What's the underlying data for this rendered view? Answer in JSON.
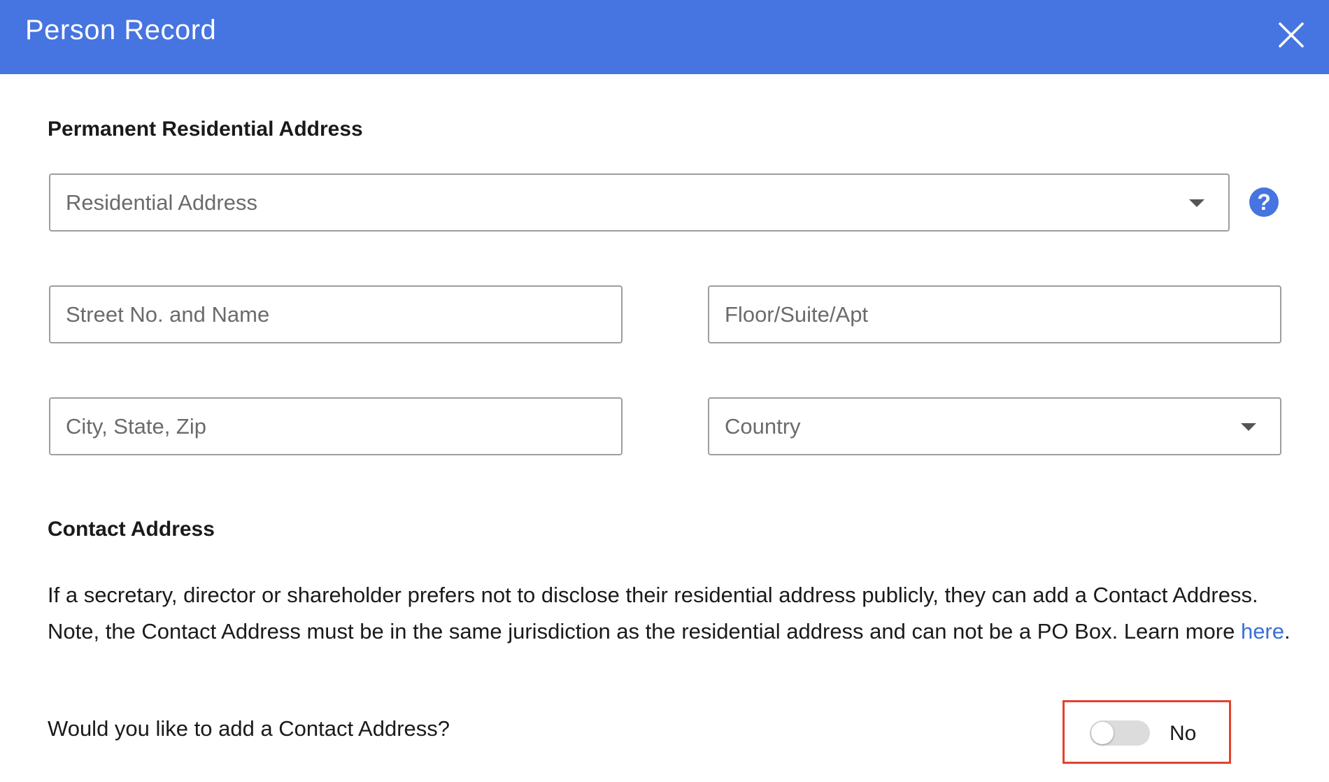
{
  "header": {
    "title": "Person Record",
    "close_icon": "close-icon",
    "background_color": "#4674e0"
  },
  "permanent_address": {
    "section_title": "Permanent Residential Address",
    "residential_address": {
      "placeholder": "Residential Address",
      "type": "dropdown"
    },
    "help_icon": "?",
    "street": {
      "placeholder": "Street No. and Name"
    },
    "floor": {
      "placeholder": "Floor/Suite/Apt"
    },
    "city": {
      "placeholder": "City, State, Zip"
    },
    "country": {
      "placeholder": "Country",
      "type": "dropdown"
    }
  },
  "contact_address": {
    "section_title": "Contact Address",
    "description_before_link": "If a secretary, director or shareholder prefers not to disclose their residential address publicly, they can add a Contact Address. Note, the Contact Address must be in the same jurisdiction as the residential address and can not be a PO Box. Learn more ",
    "link_text": "here",
    "description_after_link": ".",
    "question": "Would you like to add a Contact Address?",
    "toggle": {
      "state": "off",
      "label": "No"
    }
  },
  "colors": {
    "accent": "#4674e0",
    "link": "#3a6fd8",
    "highlight_border": "#e0442e"
  }
}
